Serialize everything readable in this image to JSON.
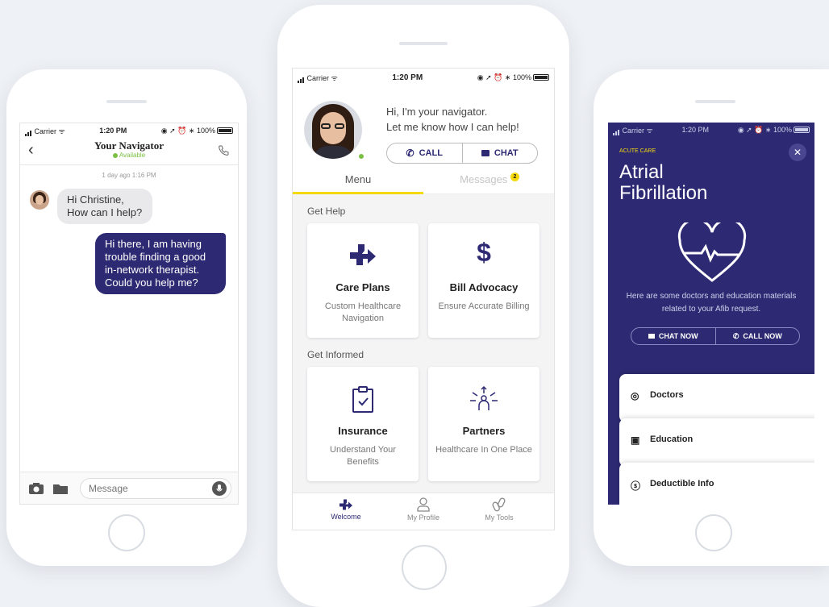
{
  "colors": {
    "navy": "#2d2a73",
    "accent_yellow": "#f5d90a",
    "green": "#7bc043"
  },
  "left_phone": {
    "status": {
      "carrier": "Carrier",
      "time": "1:20 PM",
      "battery": "100%"
    },
    "header": {
      "title": "Your Navigator",
      "status": "Available"
    },
    "timestamp": "1 day ago 1:16 PM",
    "incoming_message": "Hi Christine,\nHow can I help?",
    "outgoing_message": "Hi there, I am having trouble finding a good in-network therapist. Could you help me?",
    "composer": {
      "placeholder": "Message"
    }
  },
  "center_phone": {
    "status": {
      "carrier": "Carrier",
      "time": "1:20 PM",
      "battery": "100%"
    },
    "greeting_line1": "Hi, I'm your navigator.",
    "greeting_line2": "Let me know how I can help!",
    "call_label": "CALL",
    "chat_label": "CHAT",
    "tabs": {
      "menu": "Menu",
      "messages": "Messages",
      "messages_badge": "2"
    },
    "sections": {
      "get_help": "Get Help",
      "get_informed": "Get Informed"
    },
    "cards": [
      {
        "title": "Care Plans",
        "subtitle": "Custom Healthcare Navigation"
      },
      {
        "title": "Bill Advocacy",
        "subtitle": "Ensure Accurate Billing"
      },
      {
        "title": "Insurance",
        "subtitle": "Understand Your Benefits"
      },
      {
        "title": "Partners",
        "subtitle": "Healthcare In One Place"
      }
    ],
    "nav": {
      "welcome": "Welcome",
      "profile": "My Profile",
      "tools": "My Tools"
    }
  },
  "right_phone": {
    "status": {
      "carrier": "Carrier",
      "time": "1:20 PM",
      "battery": "100%"
    },
    "category": "ACUTE CARE",
    "title_line1": "Atrial",
    "title_line2": "Fibrillation",
    "description": "Here are some doctors and education materials related to your Afib request.",
    "chat_now": "CHAT NOW",
    "call_now": "CALL NOW",
    "items": [
      "Doctors",
      "Education",
      "Deductible Info"
    ]
  }
}
